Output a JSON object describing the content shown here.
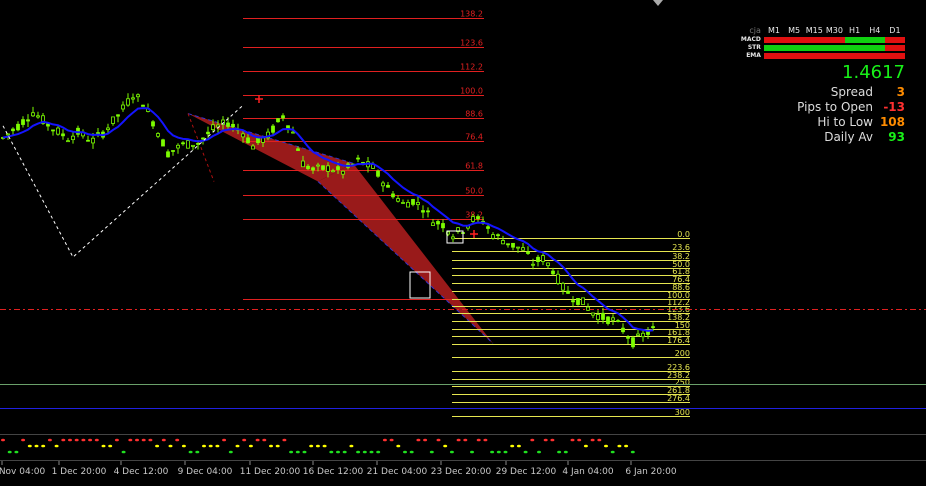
{
  "panel": {
    "symbol": "cja",
    "timeframes": [
      "M1",
      "M5",
      "M15",
      "M30",
      "H1",
      "H4",
      "D1"
    ],
    "indicators": [
      {
        "name": "MACD",
        "cells": [
          "red",
          "red",
          "red",
          "red",
          "green",
          "green",
          "red"
        ]
      },
      {
        "name": "STR",
        "cells": [
          "green",
          "green",
          "green",
          "green",
          "green",
          "green",
          "red"
        ]
      },
      {
        "name": "EMA",
        "cells": [
          "red",
          "red",
          "red",
          "red",
          "red",
          "red",
          "red"
        ]
      }
    ],
    "price": "1.4617",
    "stats": [
      {
        "label": "Spread",
        "value": "3",
        "color": "#ff8c00"
      },
      {
        "label": "Pips to Open",
        "value": "-13",
        "color": "#ff3030"
      },
      {
        "label": "Hi to Low",
        "value": "108",
        "color": "#ff8c00"
      },
      {
        "label": "Daily Av",
        "value": "93",
        "color": "#18f018"
      }
    ]
  },
  "colors": {
    "background": "#000000",
    "candle": "#7CFC00",
    "ema": "#1414ff",
    "fib_upper": "#e02020",
    "fib_lower": "#e6e650",
    "pattern_fill": "#b41e1e",
    "h_line_red": "#e02020",
    "h_line_green": "#6aa06a",
    "h_line_blue": "#2020e0",
    "cell_red": "#e01010",
    "cell_green": "#10d010"
  },
  "chart_data": {
    "type": "candlestick",
    "x_tick_labels": [
      "Nov 04:00",
      "1 Dec 20:00",
      "4 Dec 12:00",
      "9 Dec 04:00",
      "11 Dec 20:00",
      "16 Dec 12:00",
      "21 Dec 04:00",
      "23 Dec 20:00",
      "29 Dec 12:00",
      "4 Jan 04:00",
      "6 Jan 20:00"
    ],
    "fib_upper_levels": [
      "138.2",
      "123.6",
      "112.2",
      "100.0",
      "88.6",
      "76.4",
      "61.8",
      "50.0",
      "38.2"
    ],
    "fib_lower_levels": [
      "0.0",
      "23.6",
      "38.2",
      "50.0",
      "61.8",
      "76.4",
      "88.6",
      "100.0",
      "112.2",
      "123.6",
      "138.2",
      "150",
      "161.8",
      "176.4",
      "200",
      "223.6",
      "238.2",
      "250",
      "261.8",
      "276.4",
      "300"
    ],
    "price_path": [
      {
        "bar": 0,
        "price": 172
      },
      {
        "bar": 3,
        "price": 190
      },
      {
        "bar": 6,
        "price": 210
      },
      {
        "bar": 10,
        "price": 186
      },
      {
        "bar": 13,
        "price": 172
      },
      {
        "bar": 15,
        "price": 180
      },
      {
        "bar": 18,
        "price": 168
      },
      {
        "bar": 20,
        "price": 180
      },
      {
        "bar": 23,
        "price": 205
      },
      {
        "bar": 26,
        "price": 236
      },
      {
        "bar": 28,
        "price": 225
      },
      {
        "bar": 30,
        "price": 196
      },
      {
        "bar": 33,
        "price": 150
      },
      {
        "bar": 36,
        "price": 162
      },
      {
        "bar": 39,
        "price": 165
      },
      {
        "bar": 42,
        "price": 185
      },
      {
        "bar": 45,
        "price": 195
      },
      {
        "bar": 48,
        "price": 180
      },
      {
        "bar": 50,
        "price": 160
      },
      {
        "bar": 53,
        "price": 175
      },
      {
        "bar": 56,
        "price": 205
      },
      {
        "bar": 58,
        "price": 180
      },
      {
        "bar": 60,
        "price": 135
      },
      {
        "bar": 62,
        "price": 125
      },
      {
        "bar": 65,
        "price": 128
      },
      {
        "bar": 68,
        "price": 122
      },
      {
        "bar": 71,
        "price": 138
      },
      {
        "bar": 74,
        "price": 128
      },
      {
        "bar": 77,
        "price": 98
      },
      {
        "bar": 80,
        "price": 75
      },
      {
        "bar": 82,
        "price": 80
      },
      {
        "bar": 84,
        "price": 70
      },
      {
        "bar": 86,
        "price": 50
      },
      {
        "bar": 88,
        "price": 45
      },
      {
        "bar": 90,
        "price": 30
      },
      {
        "bar": 92,
        "price": 38
      },
      {
        "bar": 94,
        "price": 52
      },
      {
        "bar": 96,
        "price": 50
      },
      {
        "bar": 98,
        "price": 30
      },
      {
        "bar": 100,
        "price": 22
      },
      {
        "bar": 102,
        "price": 14
      },
      {
        "bar": 104,
        "price": 8
      },
      {
        "bar": 106,
        "price": -12
      },
      {
        "bar": 108,
        "price": -5
      },
      {
        "bar": 110,
        "price": -22
      },
      {
        "bar": 112,
        "price": -48
      },
      {
        "bar": 114,
        "price": -62
      },
      {
        "bar": 116,
        "price": -70
      },
      {
        "bar": 118,
        "price": -85
      },
      {
        "bar": 120,
        "price": -92
      },
      {
        "bar": 122,
        "price": -96
      },
      {
        "bar": 124,
        "price": -110
      },
      {
        "bar": 126,
        "price": -128
      },
      {
        "bar": 128,
        "price": -118
      },
      {
        "bar": 130,
        "price": -110
      }
    ],
    "harmonic_pattern": [
      {
        "bar": 37,
        "price": 208
      },
      {
        "bar": 63,
        "price": 108
      },
      {
        "bar": 70,
        "price": 135
      },
      {
        "bar": 98,
        "price": -130
      }
    ]
  }
}
